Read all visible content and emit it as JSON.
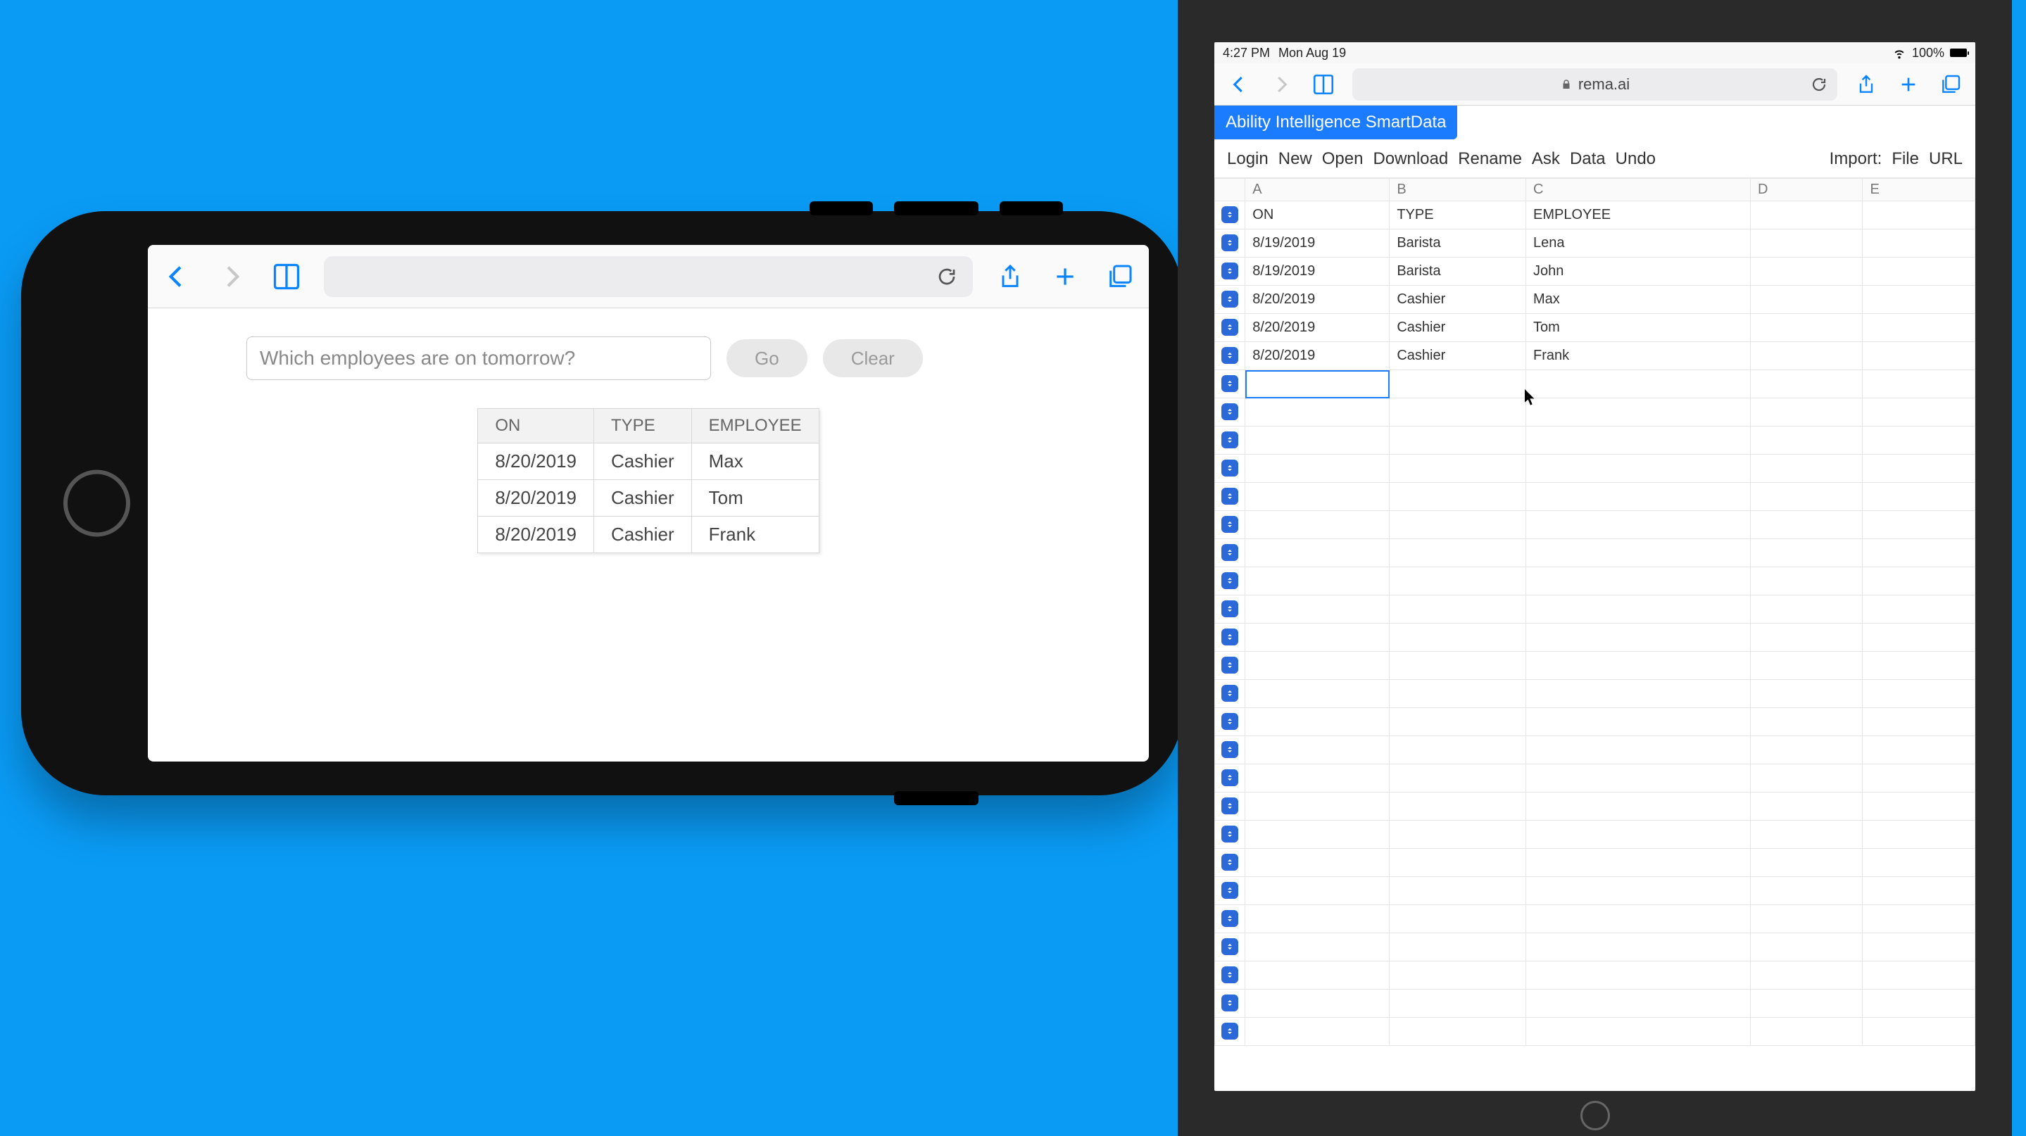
{
  "iphone": {
    "toolbar": {
      "address": ""
    },
    "query": {
      "value": "Which employees are on tomorrow?",
      "go_label": "Go",
      "clear_label": "Clear"
    },
    "result_headers": [
      "ON",
      "TYPE",
      "EMPLOYEE"
    ],
    "result_rows": [
      {
        "on": "8/20/2019",
        "type": "Cashier",
        "employee": "Max"
      },
      {
        "on": "8/20/2019",
        "type": "Cashier",
        "employee": "Tom"
      },
      {
        "on": "8/20/2019",
        "type": "Cashier",
        "employee": "Frank"
      }
    ]
  },
  "ipad": {
    "status": {
      "time": "4:27 PM",
      "date": "Mon Aug 19",
      "wifi": "wifi-icon",
      "battery_pct": "100%"
    },
    "toolbar": {
      "address": "rema.ai"
    },
    "app_badge": "Ability Intelligence SmartData",
    "menu": [
      "Login",
      "New",
      "Open",
      "Download",
      "Rename",
      "Ask",
      "Data",
      "Undo"
    ],
    "import_label": "Import:",
    "import_items": [
      "File",
      "URL"
    ],
    "column_headers": [
      "A",
      "B",
      "C",
      "D",
      "E"
    ],
    "data_rows": [
      {
        "a": "ON",
        "b": "TYPE",
        "c": "EMPLOYEE"
      },
      {
        "a": "8/19/2019",
        "b": "Barista",
        "c": "Lena"
      },
      {
        "a": "8/19/2019",
        "b": "Barista",
        "c": "John"
      },
      {
        "a": "8/20/2019",
        "b": "Cashier",
        "c": "Max"
      },
      {
        "a": "8/20/2019",
        "b": "Cashier",
        "c": "Tom"
      },
      {
        "a": "8/20/2019",
        "b": "Cashier",
        "c": "Frank"
      }
    ],
    "empty_rows": 24,
    "selected_cell": {
      "row": 6,
      "col": "A"
    }
  }
}
